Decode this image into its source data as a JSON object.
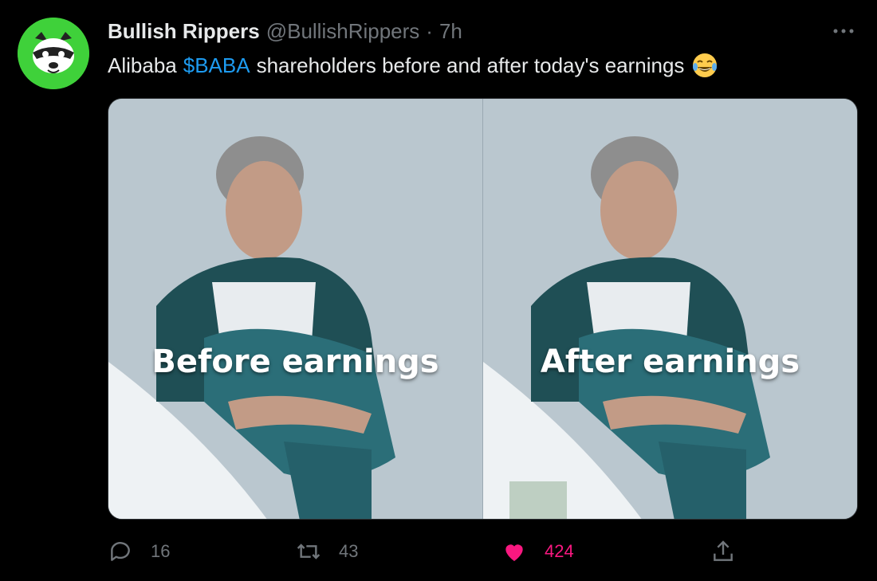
{
  "tweet": {
    "author_name": "Bullish Rippers",
    "handle": "@BullishRippers",
    "separator": "·",
    "time": "7h",
    "text_before": "Alibaba",
    "cashtag": "$BABA",
    "text_after": "shareholders before and after today's earnings",
    "emoji_icon": "tears-of-joy-icon"
  },
  "media": {
    "left_caption": "Before earnings",
    "right_caption": "After earnings"
  },
  "actions": {
    "reply_count": "16",
    "retweet_count": "43",
    "like_count": "424"
  },
  "colors": {
    "accent": "#1d9bf0",
    "like": "#f91880",
    "muted": "#71767b",
    "avatar_bg": "#3fd13a"
  }
}
